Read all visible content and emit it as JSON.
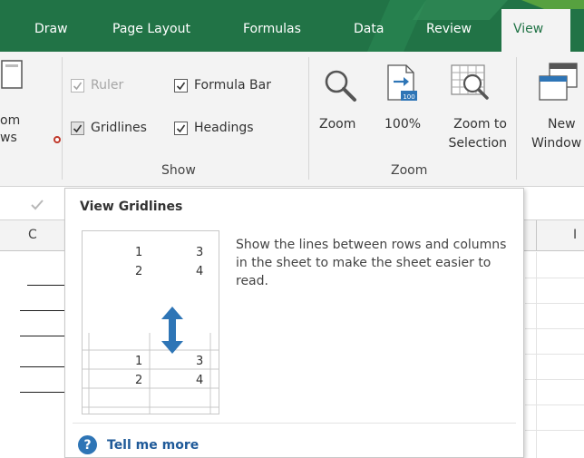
{
  "tabs": [
    {
      "label": "Draw"
    },
    {
      "label": "Page Layout"
    },
    {
      "label": "Formulas"
    },
    {
      "label": "Data"
    },
    {
      "label": "Review"
    }
  ],
  "active_tab": {
    "label": "View"
  },
  "ribbon": {
    "custom_views_partial": {
      "line1": "om",
      "line2": "ws"
    },
    "show_group": {
      "label": "Show",
      "ruler": {
        "label": "Ruler",
        "checked": true,
        "enabled": false
      },
      "formula_bar": {
        "label": "Formula Bar",
        "checked": true
      },
      "gridlines": {
        "label": "Gridlines",
        "checked": true
      },
      "headings": {
        "label": "Headings",
        "checked": true
      }
    },
    "zoom_group": {
      "label": "Zoom",
      "zoom": {
        "label": "Zoom"
      },
      "zoom100": {
        "label": "100%",
        "icon_text": "100"
      },
      "zoom_to_selection": {
        "line1": "Zoom to",
        "line2": "Selection"
      }
    },
    "new_window": {
      "line1": "New",
      "line2": "Window"
    }
  },
  "sheet": {
    "column_c": "C",
    "column_i": "I"
  },
  "tooltip": {
    "title": "View Gridlines",
    "description": "Show the lines between rows and columns in the sheet to make the sheet easier to read.",
    "illustration": {
      "top_numbers": [
        "1",
        "3",
        "2",
        "4"
      ],
      "bottom_numbers": [
        "1",
        "3",
        "2",
        "4"
      ]
    },
    "help_icon": "?",
    "tell_me_more": "Tell me more"
  },
  "colors": {
    "ribbon_green": "#217346",
    "ribbon_bg": "#f3f3f3",
    "arrow_blue": "#2e75b6",
    "link_blue": "#1f5a99"
  }
}
